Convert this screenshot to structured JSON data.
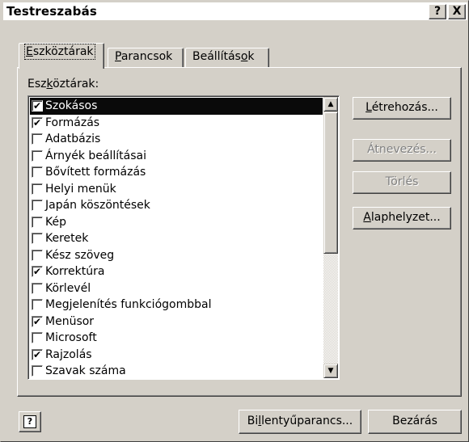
{
  "window": {
    "title": "Testreszabás",
    "help_button": "?",
    "close_button": "X"
  },
  "tabs": [
    {
      "pre": "",
      "accel": "E",
      "post": "szköztárak",
      "active": true
    },
    {
      "pre": "",
      "accel": "P",
      "post": "arancsok",
      "active": false
    },
    {
      "pre": "Beállítás",
      "accel": "o",
      "post": "k",
      "active": false
    }
  ],
  "list": {
    "label_pre": "Esz",
    "label_accel": "k",
    "label_post": "öztárak:",
    "items": [
      {
        "label": "Szokásos",
        "checked": true,
        "selected": true
      },
      {
        "label": "Formázás",
        "checked": true
      },
      {
        "label": "Adatbázis",
        "checked": false
      },
      {
        "label": "Árnyék beállításai",
        "checked": false
      },
      {
        "label": "Bővített formázás",
        "checked": false
      },
      {
        "label": "Helyi menük",
        "checked": false
      },
      {
        "label": "Japán köszöntések",
        "checked": false
      },
      {
        "label": "Kép",
        "checked": false
      },
      {
        "label": "Keretek",
        "checked": false
      },
      {
        "label": "Kész szöveg",
        "checked": false
      },
      {
        "label": "Korrektúra",
        "checked": true
      },
      {
        "label": "Körlevél",
        "checked": false
      },
      {
        "label": "Megjelenítés funkciógombbal",
        "checked": false
      },
      {
        "label": "Menüsor",
        "checked": true
      },
      {
        "label": "Microsoft",
        "checked": false
      },
      {
        "label": "Rajzolás",
        "checked": true
      },
      {
        "label": "Szavak száma",
        "checked": false
      }
    ],
    "scroll_up": "▲",
    "scroll_down": "▼",
    "check_mark": "✔"
  },
  "buttons": {
    "new_pre": "",
    "new_accel": "L",
    "new_post": "étrehozás...",
    "rename": "Átnevezés...",
    "delete": "Törlés",
    "reset_pre": "",
    "reset_accel": "A",
    "reset_post": "laphelyzet...",
    "keyboard_pre": "Bi",
    "keyboard_accel": "l",
    "keyboard_post": "lentyűparancs...",
    "close": "Bezárás",
    "help_glyph": "?"
  }
}
